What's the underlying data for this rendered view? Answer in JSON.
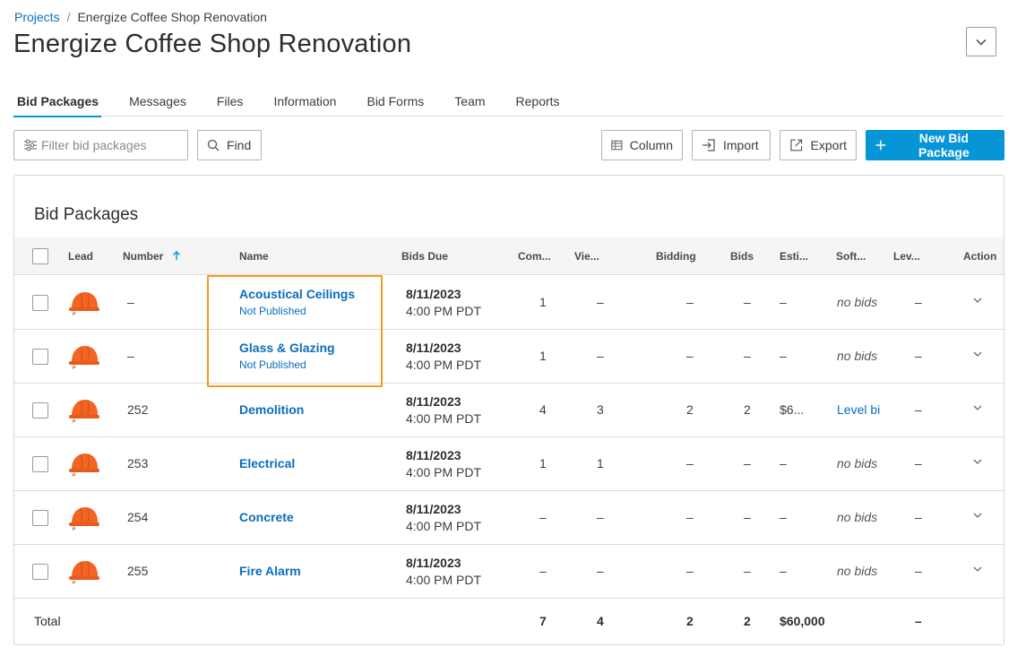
{
  "breadcrumb": {
    "root": "Projects",
    "separator": "/",
    "current": "Energize Coffee Shop Renovation"
  },
  "page_title": "Energize Coffee Shop Renovation",
  "tabs": [
    {
      "label": "Bid Packages",
      "active": true
    },
    {
      "label": "Messages",
      "active": false
    },
    {
      "label": "Files",
      "active": false
    },
    {
      "label": "Information",
      "active": false
    },
    {
      "label": "Bid Forms",
      "active": false
    },
    {
      "label": "Team",
      "active": false
    },
    {
      "label": "Reports",
      "active": false
    }
  ],
  "toolbar": {
    "filter_placeholder": "Filter bid packages",
    "find_label": "Find",
    "column_label": "Column",
    "import_label": "Import",
    "export_label": "Export",
    "new_label": "New Bid Package"
  },
  "colors": {
    "accent": "#0696d7",
    "link": "#0a6ebd",
    "highlight": "#f79a1e",
    "helmet": "#f26522"
  },
  "table": {
    "title": "Bid Packages",
    "columns": {
      "lead": "Lead",
      "number": "Number",
      "name": "Name",
      "bids_due": "Bids Due",
      "com": "Com...",
      "vie": "Vie...",
      "bidding": "Bidding",
      "bids": "Bids",
      "esti": "Esti...",
      "soft": "Soft...",
      "lev": "Lev...",
      "action": "Action"
    },
    "rows": [
      {
        "number": "–",
        "name": "Acoustical Ceilings",
        "status": "Not Published",
        "due_date": "8/11/2023",
        "due_time": "4:00 PM PDT",
        "com": "1",
        "vie": "–",
        "bidding": "–",
        "bids": "–",
        "esti": "–",
        "soft": "no bids",
        "soft_italic": true,
        "lev": "–"
      },
      {
        "number": "–",
        "name": "Glass & Glazing",
        "status": "Not Published",
        "due_date": "8/11/2023",
        "due_time": "4:00 PM PDT",
        "com": "1",
        "vie": "–",
        "bidding": "–",
        "bids": "–",
        "esti": "–",
        "soft": "no bids",
        "soft_italic": true,
        "lev": "–"
      },
      {
        "number": "252",
        "name": "Demolition",
        "status": "",
        "due_date": "8/11/2023",
        "due_time": "4:00 PM PDT",
        "com": "4",
        "vie": "3",
        "bidding": "2",
        "bids": "2",
        "esti": "$6...",
        "soft": "Level bi",
        "soft_link": true,
        "lev": "–"
      },
      {
        "number": "253",
        "name": "Electrical",
        "status": "",
        "due_date": "8/11/2023",
        "due_time": "4:00 PM PDT",
        "com": "1",
        "vie": "1",
        "bidding": "–",
        "bids": "–",
        "esti": "–",
        "soft": "no bids",
        "soft_italic": true,
        "lev": "–"
      },
      {
        "number": "254",
        "name": "Concrete",
        "status": "",
        "due_date": "8/11/2023",
        "due_time": "4:00 PM PDT",
        "com": "–",
        "vie": "–",
        "bidding": "–",
        "bids": "–",
        "esti": "–",
        "soft": "no bids",
        "soft_italic": true,
        "lev": "–"
      },
      {
        "number": "255",
        "name": "Fire Alarm",
        "status": "",
        "due_date": "8/11/2023",
        "due_time": "4:00 PM PDT",
        "com": "–",
        "vie": "–",
        "bidding": "–",
        "bids": "–",
        "esti": "–",
        "soft": "no bids",
        "soft_italic": true,
        "lev": "–"
      }
    ],
    "total": {
      "label": "Total",
      "com": "7",
      "vie": "4",
      "bidding": "2",
      "bids": "2",
      "esti": "$60,000",
      "lev": "–"
    }
  }
}
